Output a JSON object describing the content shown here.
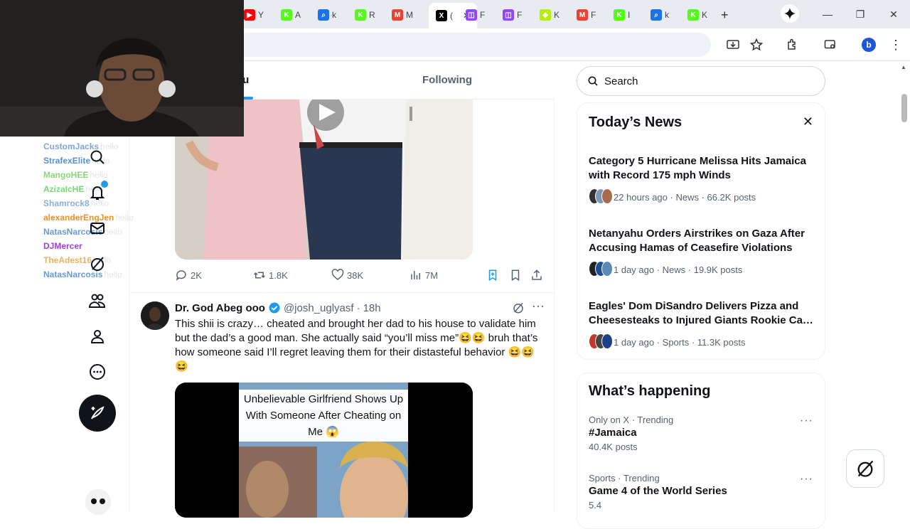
{
  "browser": {
    "tabs": [
      {
        "label": "Y",
        "color": "#ff0000",
        "glyph": "▶"
      },
      {
        "label": "A",
        "color": "#53fc18",
        "glyph": "K"
      },
      {
        "label": "k",
        "color": "#1a73e8",
        "glyph": "⌕"
      },
      {
        "label": "R",
        "color": "#53fc18",
        "glyph": "K"
      },
      {
        "label": "M",
        "color": "#ea4335",
        "glyph": "M"
      },
      {
        "label": "(",
        "color": "#000000",
        "glyph": "X"
      },
      {
        "label": "F",
        "color": "#9146ff",
        "glyph": "◫"
      },
      {
        "label": "F",
        "color": "#9146ff",
        "glyph": "◫"
      },
      {
        "label": "K",
        "color": "#b4f000",
        "glyph": "◆"
      },
      {
        "label": "F",
        "color": "#ea4335",
        "glyph": "M"
      },
      {
        "label": "I",
        "color": "#53fc18",
        "glyph": "K"
      },
      {
        "label": "k",
        "color": "#1a73e8",
        "glyph": "⌕"
      },
      {
        "label": "K",
        "color": "#53fc18",
        "glyph": "K"
      }
    ],
    "new_tab": "+",
    "close_tab": "✕",
    "profile_initial": "b"
  },
  "chat_overlay": {
    "names": [
      {
        "name": "CustomJacks",
        "color": "#7fa6d6",
        "suffix": "hello"
      },
      {
        "name": "StrafexElite",
        "color": "#5a8fd0",
        "suffix": "hello"
      },
      {
        "name": "MangoHEE",
        "color": "#8ad67a",
        "suffix": "hello"
      },
      {
        "name": "AzizaIcHE",
        "color": "#7ad67a",
        "suffix": "hello"
      },
      {
        "name": "Shamrock8",
        "color": "#8ab0d6",
        "suffix": "hello"
      },
      {
        "name": "alexanderEngJen",
        "color": "#e8922e",
        "suffix": "hello"
      },
      {
        "name": "NatasNarcosis",
        "color": "#6a9ad0",
        "suffix": "hello"
      },
      {
        "name": "DJMercer",
        "color": "#a040d0",
        "suffix": ""
      },
      {
        "name": "TheAdest16",
        "color": "#e8b060",
        "suffix": "hello"
      },
      {
        "name": "NatasNarcosis",
        "color": "#6a9ad0",
        "suffix": "hello"
      }
    ]
  },
  "feed": {
    "tab_for_you": "ou",
    "tab_following": "Following",
    "post1_actions": {
      "replies": "2K",
      "reposts": "1.8K",
      "likes": "38K",
      "views": "7M"
    },
    "tweet": {
      "author": "Dr. God Abeg ooo",
      "handle": "@josh_uglyasf",
      "dot": "·",
      "time": "18h",
      "text": "This shii is crazy… cheated and brought her dad to his house to validate him but the dad’s a good man. She actually said “you’ll miss me”😆😆 bruh that’s how someone said I’ll regret leaving them for their distasteful behavior 😆😆😆",
      "video_caption": "Unbelievable Girlfriend Shows Up With Someone After Cheating on Me 😱"
    }
  },
  "right_column": {
    "search_placeholder": "Search",
    "todays_news": {
      "title": "Today’s News",
      "items": [
        {
          "headline": "Category 5 Hurricane Melissa Hits Jamaica with Record 175 mph Winds",
          "meta": "22 hours ago · News · 66.2K posts"
        },
        {
          "headline": "Netanyahu Orders Airstrikes on Gaza After Accusing Hamas of Ceasefire Violations",
          "meta": "1 day ago · News · 19.9K posts"
        },
        {
          "headline": "Eagles' Dom DiSandro Delivers Pizza and Cheesesteaks to Injured Giants Rookie Ca…",
          "meta": "1 day ago · Sports · 11.3K posts"
        }
      ]
    },
    "whats_happening": {
      "title": "What’s happening",
      "trends": [
        {
          "context": "Only on X · Trending",
          "name": "#Jamaica",
          "count": "40.4K posts"
        },
        {
          "context": "Sports · Trending",
          "name": "Game 4 of the World Series",
          "count": "5.4"
        }
      ]
    }
  }
}
